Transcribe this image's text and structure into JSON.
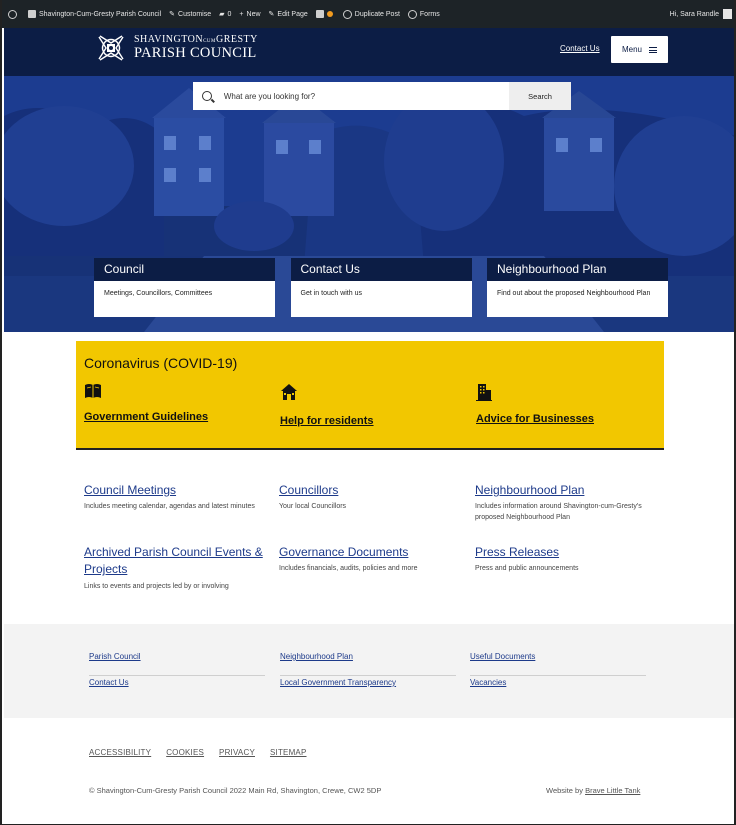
{
  "admin_bar": {
    "site_name": "Shavington-Cum-Gresty Parish Council",
    "customise": "Customise",
    "comments": "0",
    "new": "New",
    "edit_page": "Edit Page",
    "duplicate_post": "Duplicate Post",
    "forms": "Forms",
    "greeting": "Hi, Sara Randle"
  },
  "header": {
    "logo_line1": "SHAVINGTON",
    "logo_cum": "CUM",
    "logo_line1b": "GRESTY",
    "logo_line2": "PARISH COUNCIL",
    "contact_label": "Contact Us",
    "menu_label": "Menu"
  },
  "search": {
    "placeholder": "What are you looking for?",
    "button_label": "Search"
  },
  "cards": [
    {
      "title": "Council",
      "desc": "Meetings, Councillors, Committees"
    },
    {
      "title": "Contact Us",
      "desc": "Get in touch with us"
    },
    {
      "title": "Neighbourhood Plan",
      "desc": "Find out about the proposed Neighbourhood Plan"
    }
  ],
  "covid": {
    "title": "Coronavirus (COVID-19)",
    "items": [
      {
        "label": "Government Guidelines",
        "icon": "book-icon"
      },
      {
        "label": "Help for residents",
        "icon": "house-icon"
      },
      {
        "label": "Advice for Businesses",
        "icon": "building-icon"
      }
    ]
  },
  "links": [
    {
      "title": "Council Meetings",
      "desc": "Includes meeting calendar, agendas and latest minutes"
    },
    {
      "title": "Councillors",
      "desc": "Your local Councillors"
    },
    {
      "title": "Neighbourhood Plan",
      "desc": "Includes information around Shavington-cum-Gresty's proposed Neighbourhood Plan"
    },
    {
      "title": "Archived Parish Council Events & Projects",
      "desc": "Links to events and projects led by or involving"
    },
    {
      "title": "Governance Documents",
      "desc": "Includes financials, audits, policies and more"
    },
    {
      "title": "Press Releases",
      "desc": "Press and public announcements"
    }
  ],
  "footer_links": [
    [
      "Parish Council",
      "Contact Us"
    ],
    [
      "Neighbourhood Plan",
      "Local Government Transparency"
    ],
    [
      "Useful Documents",
      "Vacancies"
    ]
  ],
  "legal": [
    "ACCESSIBILITY",
    "COOKIES",
    "PRIVACY",
    "SITEMAP"
  ],
  "copyright": "© Shavington-Cum-Gresty Parish Council 2022 Main Rd, Shavington, Crewe, CW2 5DP",
  "credit_prefix": "Website by",
  "credit_link": "Brave Little Tank",
  "colors": {
    "navy": "#0c1d45",
    "hero_blue": "#1a3a8c",
    "covid_yellow": "#f2c700",
    "link_blue": "#1d3a8a"
  }
}
